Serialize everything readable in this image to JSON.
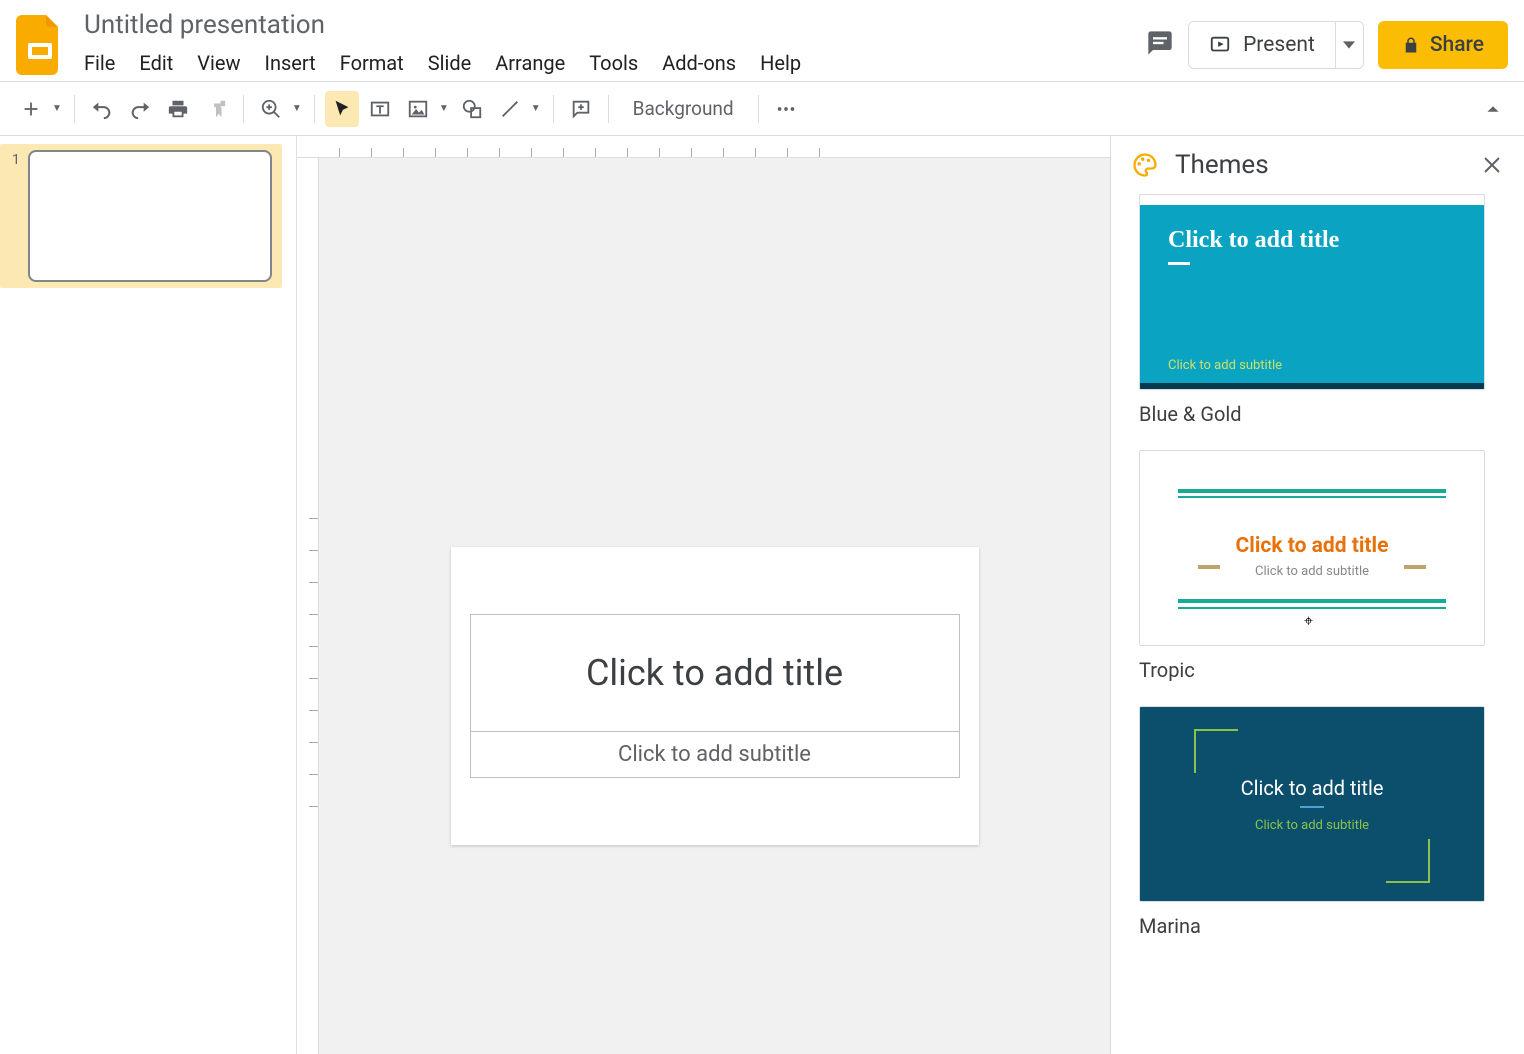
{
  "header": {
    "title": "Untitled presentation",
    "menu": [
      "File",
      "Edit",
      "View",
      "Insert",
      "Format",
      "Slide",
      "Arrange",
      "Tools",
      "Add-ons",
      "Help"
    ],
    "present": "Present",
    "share": "Share"
  },
  "toolbar": {
    "background": "Background"
  },
  "slidenav": {
    "slide_number": "1"
  },
  "slide": {
    "title_placeholder": "Click to add title",
    "subtitle_placeholder": "Click to add subtitle"
  },
  "themes": {
    "heading": "Themes",
    "list": [
      {
        "name": "Blue & Gold",
        "title": "Click to add title",
        "subtitle": "Click to add subtitle"
      },
      {
        "name": "Tropic",
        "title": "Click to add title",
        "subtitle": "Click to add subtitle"
      },
      {
        "name": "Marina",
        "title": "Click to add title",
        "subtitle": "Click to add subtitle"
      }
    ]
  }
}
